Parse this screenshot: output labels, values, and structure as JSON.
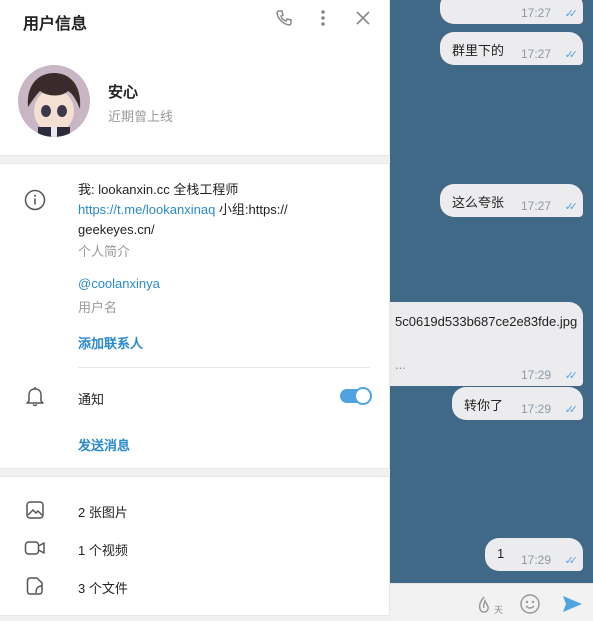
{
  "panel": {
    "title": "用户信息",
    "user": {
      "name": "安心",
      "status": "近期曾上线"
    },
    "info": {
      "bio_prefix": "我: lookanxin.cc 全栈工程师",
      "bio_link": "https://t.me/lookanxinaq",
      "bio_suffix": " 小组:https://",
      "bio_line3": "geekeyes.cn/",
      "bio_label": "个人简介",
      "username": "@coolanxinya",
      "username_label": "用户名",
      "add_contact": "添加联系人"
    },
    "notifications": {
      "label": "通知",
      "enabled": true
    },
    "send_message": "发送消息",
    "media": [
      {
        "label": "2 张图片",
        "icon": "image-icon"
      },
      {
        "label": "1 个视频",
        "icon": "video-icon"
      },
      {
        "label": "3 个文件",
        "icon": "file-icon"
      }
    ]
  },
  "chat": {
    "messages": [
      {
        "text": "",
        "time": "17:27"
      },
      {
        "text": "群里下的",
        "time": "17:27"
      },
      {
        "text": "这么夸张",
        "time": "17:27"
      },
      {
        "text": "5c0619d533b687ce2e83fde.jpg",
        "subtext": "...",
        "time": "17:29"
      },
      {
        "text": "转你了",
        "time": "17:29"
      },
      {
        "text": "1",
        "time": "17:29"
      }
    ],
    "composer_badge": "天"
  },
  "colors": {
    "accent": "#2a8acb",
    "chat_bg": "#3f6986",
    "toggle": "#4fa3e0"
  }
}
